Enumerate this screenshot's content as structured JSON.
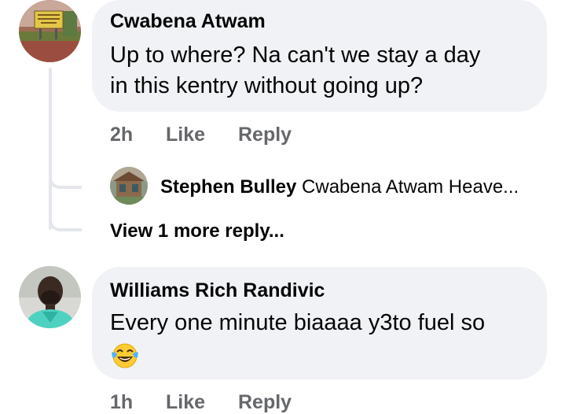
{
  "comments": [
    {
      "author": "Cwabena Atwam",
      "text_line1": "Up to where? Na can't we stay a day",
      "text_line2": "in this kentry without going up?",
      "time": "2h",
      "like_label": "Like",
      "reply_label": "Reply",
      "avatar_sign_text": "WELCOME TO GAMBAGA BIBLE HOME",
      "replies": [
        {
          "author": "Stephen Bulley",
          "preview": "Cwabena Atwam Heave..."
        }
      ],
      "view_more_label": "View 1 more reply..."
    },
    {
      "author": "Williams Rich Randivic",
      "text_line1": "Every one minute biaaaa y3to fuel so",
      "emoji_name": "face-with-tears-of-joy",
      "time": "1h",
      "like_label": "Like",
      "reply_label": "Reply"
    }
  ],
  "colors": {
    "bubble": "#f0f2f5",
    "meta_text": "#65676b",
    "thread_line": "#e4e6eb",
    "primary_text": "#050505"
  }
}
